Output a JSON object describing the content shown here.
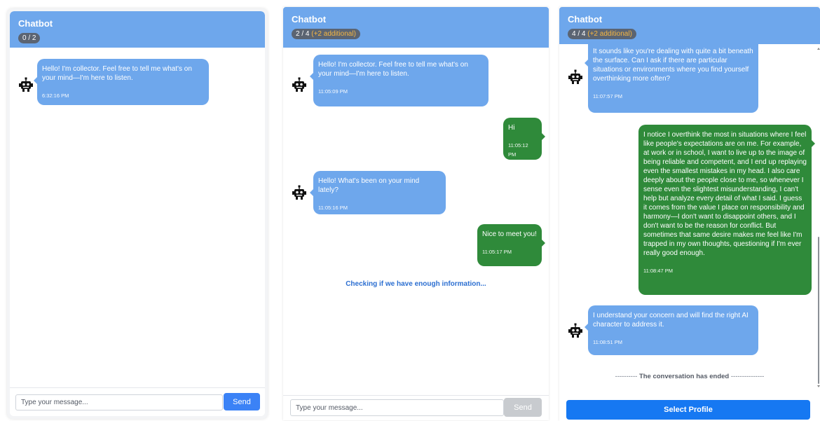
{
  "colors": {
    "header": "#6ea7ec",
    "bot_bubble": "#6ea7ec",
    "user_bubble": "#2f8a3a",
    "send_active": "#3b82f6",
    "send_disabled": "#c8cbcf",
    "select_button": "#1678f2",
    "status_link": "#2c6fd1",
    "additional_badge": "#f5b642"
  },
  "icons": {
    "avatar": "robot-icon"
  },
  "panel1": {
    "title": "Chatbot",
    "counter": "0 / 2",
    "messages": [
      {
        "role": "bot",
        "text": "Hello! I'm collector. Feel free to tell me what's on your mind—I'm here to listen.",
        "time": "6:32:16 PM"
      }
    ],
    "input_placeholder": "Type your message...",
    "send_label": "Send"
  },
  "panel2": {
    "title": "Chatbot",
    "counter": "2 / 4",
    "counter_extra": "(+2 additional)",
    "messages": [
      {
        "role": "bot",
        "text": "Hello! I'm collector. Feel free to tell me what's on your mind—I'm here to listen.",
        "time": "11:05:09 PM"
      },
      {
        "role": "user",
        "text": "Hi",
        "time": "11:05:12 PM"
      },
      {
        "role": "bot",
        "text": "Hello! What's been on your mind lately?",
        "time": "11:05:16 PM"
      },
      {
        "role": "user",
        "text": "Nice to meet you!",
        "time": "11:05:17 PM"
      }
    ],
    "status": "Checking if we have enough information...",
    "input_placeholder": "Type your message...",
    "send_label": "Send"
  },
  "panel3": {
    "title": "Chatbot",
    "counter": "4 / 4",
    "counter_extra": "(+2 additional)",
    "messages": [
      {
        "role": "bot",
        "text": "It sounds like you're dealing with quite a bit beneath the surface. Can I ask if there are particular situations or environments where you find yourself overthinking more often?",
        "time": "11:07:57 PM"
      },
      {
        "role": "user",
        "text": "I notice I overthink the most in situations where I feel like people's expectations are on me. For example, at work or in school, I want to live up to the image of being reliable and competent, and I end up replaying even the smallest mistakes in my head. I also care deeply about the people close to me, so whenever I sense even the slightest misunderstanding, I can't help but analyze every detail of what I said. I guess it comes from the value I place on responsibility and harmony—I don't want to disappoint others, and I don't want to be the reason for conflict. But sometimes that same desire makes me feel like I'm trapped in my own thoughts, questioning if I'm ever really good enough.",
        "time": "11:08:47 PM"
      },
      {
        "role": "bot",
        "text": "I understand your concern and will find the right AI character to address it.",
        "time": "11:08:51 PM"
      }
    ],
    "ended_left": "----------",
    "ended_label": "The conversation has ended",
    "ended_right": "---------------",
    "select_label": "Select Profile"
  }
}
